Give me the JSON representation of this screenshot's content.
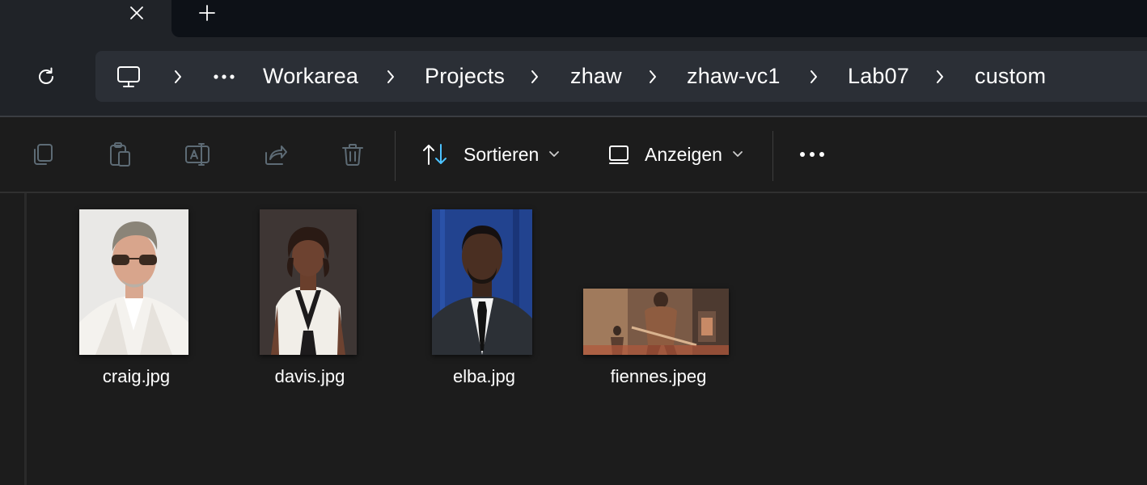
{
  "tabbar": {
    "close_icon": "close-icon",
    "new_tab_icon": "plus-icon"
  },
  "address": {
    "refresh_icon": "refresh-icon",
    "root_icon": "this-pc-icon",
    "overflow": "···",
    "crumbs": [
      "Workarea",
      "Projects",
      "zhaw",
      "zhaw-vc1",
      "Lab07",
      "custom"
    ]
  },
  "toolbar": {
    "copy_icon": "copy-icon",
    "paste_icon": "paste-icon",
    "rename_icon": "rename-icon",
    "share_icon": "share-icon",
    "delete_icon": "delete-icon",
    "sort_label": "Sortieren",
    "view_label": "Anzeigen",
    "more_label": "•••"
  },
  "files": [
    {
      "name": "craig.jpg"
    },
    {
      "name": "davis.jpg"
    },
    {
      "name": "elba.jpg"
    },
    {
      "name": "fiennes.jpeg"
    }
  ],
  "colors": {
    "accent": "#4cc2ff",
    "background": "#1c1c1c",
    "chrome": "#202328"
  }
}
